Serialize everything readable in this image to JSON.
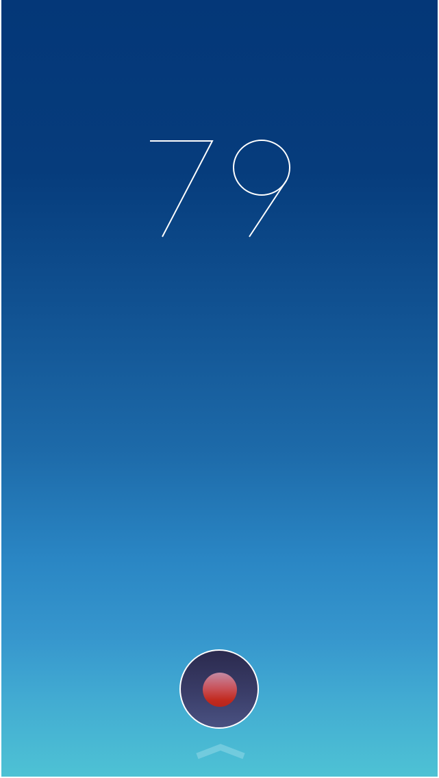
{
  "counter": {
    "value": "79"
  },
  "controls": {
    "record_icon": "record-icon",
    "swipe_icon": "chevron-up-icon"
  },
  "colors": {
    "background_top": "#043778",
    "background_bottom": "#4ec2d4",
    "digit_stroke": "#ffffff",
    "record_button_bg": "#33355c",
    "record_dot": "#c22a1e"
  }
}
